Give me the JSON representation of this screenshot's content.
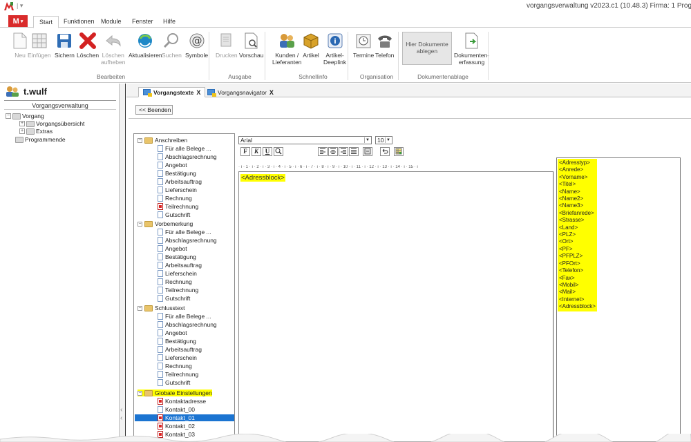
{
  "titlebar": {
    "title": "vorgangsverwaltung  v2023.c1 (10.48.3)     Firma: 1  Progr"
  },
  "tabs": [
    "Start",
    "Funktionen",
    "Module",
    "Fenster",
    "Hilfe"
  ],
  "ribbon": {
    "buttons": {
      "neu": "Neu",
      "einfuegen": "Einfügen",
      "sichern": "Sichern",
      "loeschen": "Löschen",
      "loeschen_aufheben_1": "Löschen",
      "loeschen_aufheben_2": "aufheben",
      "aktualisieren": "Aktualisieren",
      "suchen": "Suchen",
      "symbole": "Symbole",
      "drucken": "Drucken",
      "vorschau": "Vorschau",
      "kunden_1": "Kunden /",
      "kunden_2": "Lieferanten",
      "artikel": "Artikel",
      "artikel_deeplink_1": "Artikel-",
      "artikel_deeplink_2": "Deeplink",
      "termine": "Termine",
      "telefon": "Telefon",
      "hier_dokumente_1": "Hier Dokumente",
      "hier_dokumente_2": "ablegen",
      "dokumentenerfassung_1": "Dokumenten-",
      "dokumentenerfassung_2": "erfassung"
    },
    "groups": {
      "bearbeiten": "Bearbeiten",
      "ausgabe": "Ausgabe",
      "schnellinfo": "Schnellinfo",
      "organisation": "Organisation",
      "dokumentenablage": "Dokumentenablage"
    }
  },
  "leftpanel": {
    "user": "t.wulf",
    "header": "Vorgangsverwaltung",
    "tree": {
      "vorgang": "Vorgang",
      "vorgangsuebersicht": "Vorgangsübersicht",
      "extras": "Extras",
      "programmende": "Programmende"
    }
  },
  "doctabs": {
    "tab1": "Vorgangstexte",
    "tab2": "Vorgangsnavigator",
    "close": "X"
  },
  "toolbar": {
    "beenden": "<< Beenden"
  },
  "tree": {
    "anschreiben": {
      "label": "Anschreiben",
      "items": [
        "Für alle Belege ...",
        "Abschlagsrechnung",
        "Angebot",
        "Bestätigung",
        "Arbeitsauftrag",
        "Lieferschein",
        "Rechnung",
        "Teilrechnung",
        "Gutschrift"
      ]
    },
    "vorbemerkung": {
      "label": "Vorbemerkung",
      "items": [
        "Für alle Belege ...",
        "Abschlagsrechnung",
        "Angebot",
        "Bestätigung",
        "Arbeitsauftrag",
        "Lieferschein",
        "Rechnung",
        "Teilrechnung",
        "Gutschrift"
      ]
    },
    "schlusstext": {
      "label": "Schlusstext",
      "items": [
        "Für alle Belege ...",
        "Abschlagsrechnung",
        "Angebot",
        "Bestätigung",
        "Arbeitsauftrag",
        "Lieferschein",
        "Rechnung",
        "Teilrechnung",
        "Gutschrift"
      ]
    },
    "globale": {
      "label": "Globale Einstellungen",
      "items": [
        "Kontaktadresse",
        "Kontakt_00",
        "Kontakt_01",
        "Kontakt_02",
        "Kontakt_03"
      ]
    }
  },
  "editor": {
    "font": "Arial",
    "size": "10",
    "format_buttons": {
      "bold": "F",
      "italic": "K",
      "underline": "U"
    },
    "ruler": "· ı · 1 · ı · 2 · ı · 3 · ı · 4 · ı · 5 · ı · 6 · ı · 7 · ı · 8 · ı · 9 · ı · 10 · ı · 11 · ı · 12 · ı · 13 · ı · 14 · ı · 15 · ı",
    "content": "<Adressblock>"
  },
  "placeholders": [
    "<Adresstyp>",
    "<Anrede>",
    "<Vorname>",
    "<Titel>",
    "<Name>",
    "<Name2>",
    "<Name3>",
    "<Briefanrede>",
    "<Strasse>",
    "<Land>",
    "<PLZ>",
    "<Ort>",
    "<PF>",
    "<PFPLZ>",
    "<PFOrt>",
    "<Telefon>",
    "<Fax>",
    "<Mobil>",
    "<Mail>",
    "<Internet>",
    "<Adressblock>"
  ],
  "colors": {
    "accent": "#d92b2b",
    "highlight": "#ffff00",
    "selection": "#1b74d1"
  }
}
